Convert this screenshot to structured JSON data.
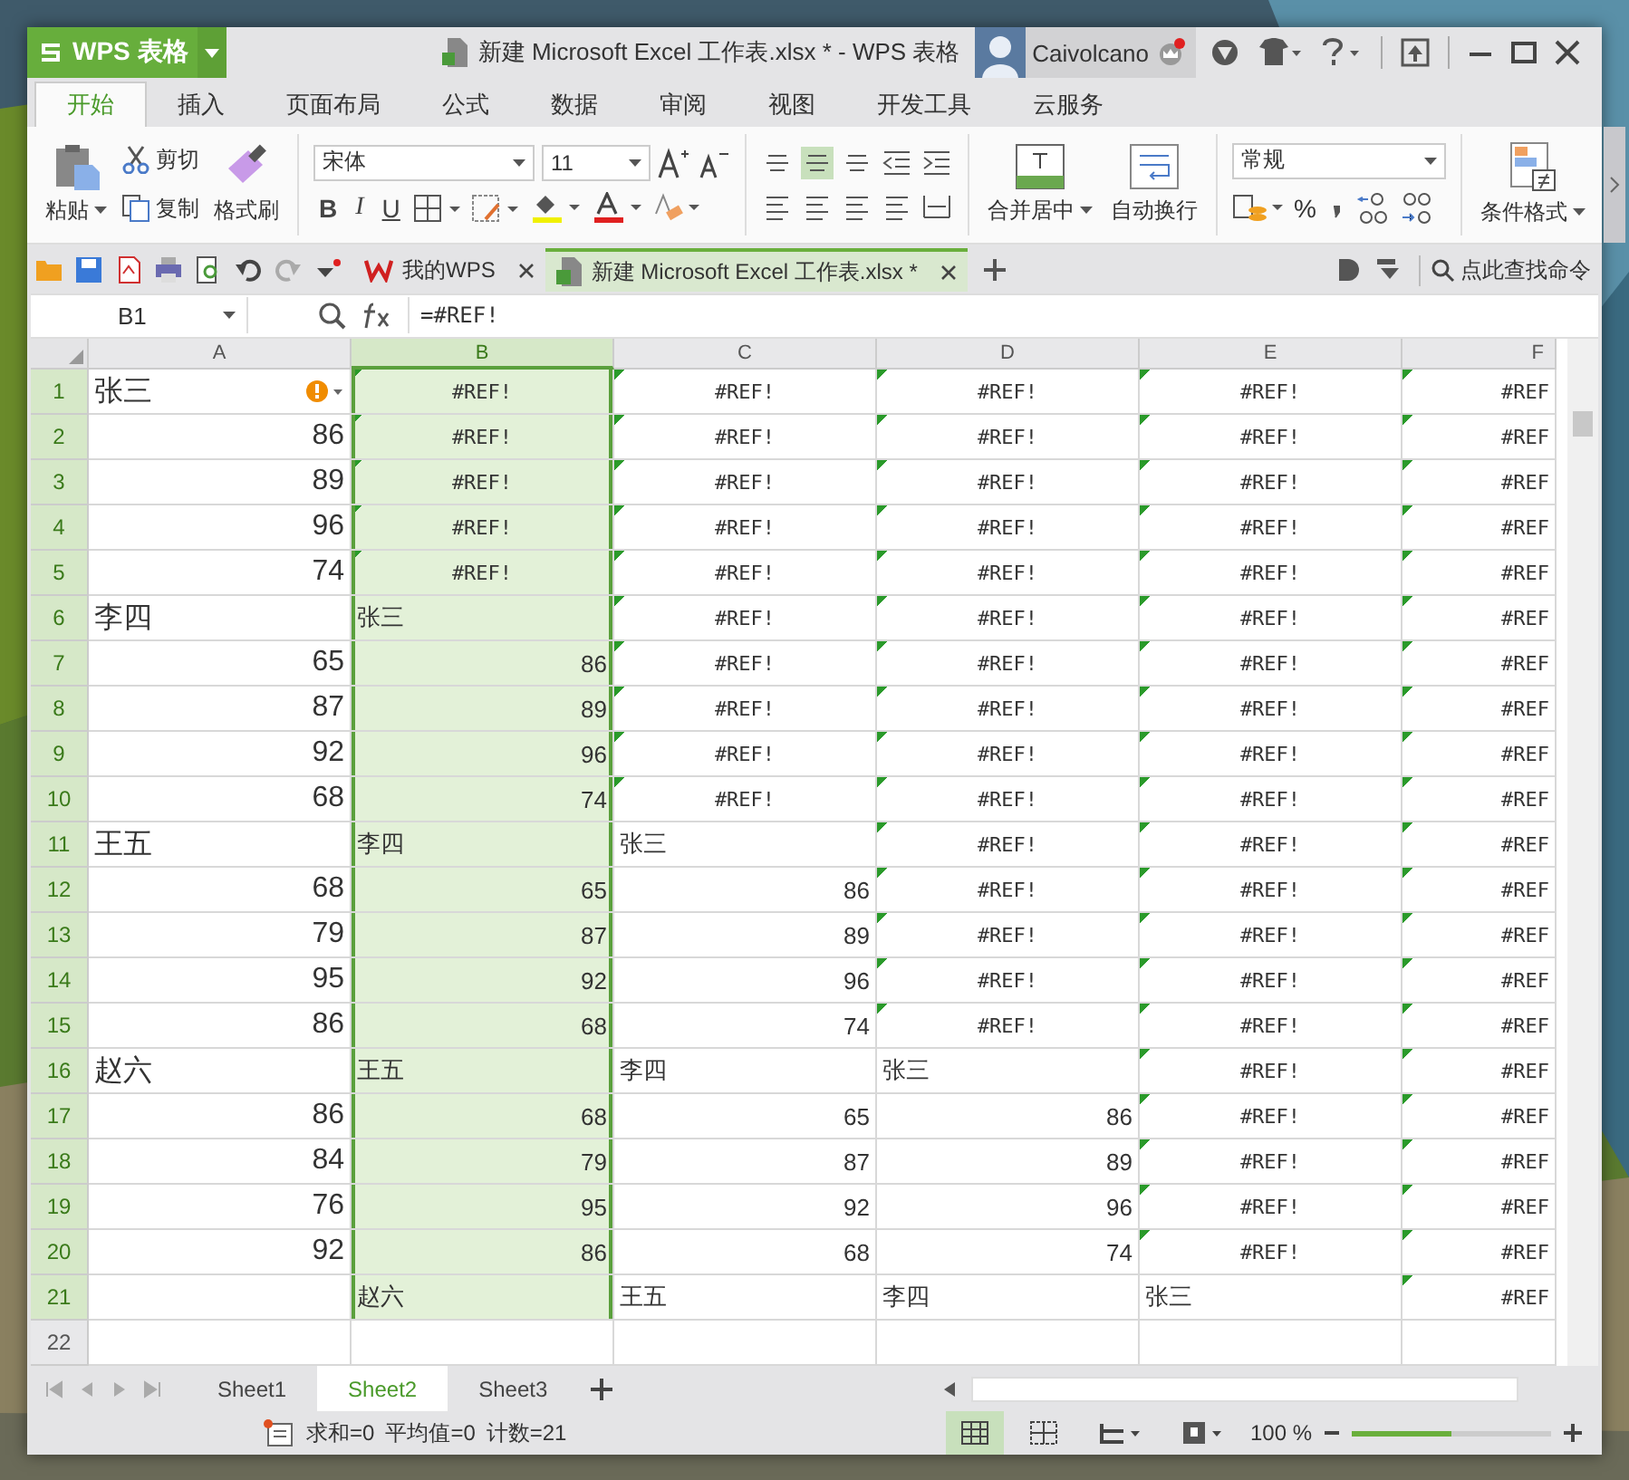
{
  "app_button": {
    "label": "WPS 表格"
  },
  "window": {
    "title": "新建 Microsoft Excel 工作表.xlsx * - WPS 表格"
  },
  "user": {
    "name": "Caivolcano",
    "notification": true
  },
  "ribbon_tabs": [
    {
      "label": "开始",
      "selected": true
    },
    {
      "label": "插入",
      "selected": false
    },
    {
      "label": "页面布局",
      "selected": false
    },
    {
      "label": "公式",
      "selected": false
    },
    {
      "label": "数据",
      "selected": false
    },
    {
      "label": "审阅",
      "selected": false
    },
    {
      "label": "视图",
      "selected": false
    },
    {
      "label": "开发工具",
      "selected": false
    },
    {
      "label": "云服务",
      "selected": false
    }
  ],
  "clipboard": {
    "paste": "粘贴",
    "cut": "剪切",
    "copy": "复制",
    "format_painter": "格式刷"
  },
  "font": {
    "name": "宋体",
    "size": "11"
  },
  "style_buttons": [
    "B",
    "I",
    "U"
  ],
  "alignment": {
    "merge": "合并居中",
    "wrap": "自动换行"
  },
  "number": {
    "format": "常规",
    "percent": "%"
  },
  "conditional_format": "条件格式",
  "doc_tabs": [
    {
      "label": "我的WPS",
      "kind": "home",
      "selected": false
    },
    {
      "label": "新建 Microsoft Excel 工作表.xlsx *",
      "kind": "sheet",
      "selected": true
    }
  ],
  "command_search": {
    "placeholder": "点此查找命令"
  },
  "formula_bar": {
    "name_box": "B1",
    "formula": "=#REF!"
  },
  "columns": [
    {
      "label": "A",
      "selected": false
    },
    {
      "label": "B",
      "selected": true
    },
    {
      "label": "C",
      "selected": false
    },
    {
      "label": "D",
      "selected": false
    },
    {
      "label": "E",
      "selected": false
    },
    {
      "label": "F",
      "selected": false
    }
  ],
  "rows": [
    {
      "label": "1",
      "selected": true,
      "cells": [
        {
          "kind": "name",
          "text": "张三",
          "warning": true
        },
        {
          "kind": "ref",
          "text": "#REF!"
        },
        {
          "kind": "ref",
          "text": "#REF!"
        },
        {
          "kind": "ref",
          "text": "#REF!"
        },
        {
          "kind": "ref",
          "text": "#REF!"
        },
        {
          "kind": "ref",
          "text": "#REF"
        }
      ]
    },
    {
      "label": "2",
      "selected": true,
      "cells": [
        {
          "kind": "num",
          "text": "86"
        },
        {
          "kind": "ref",
          "text": "#REF!"
        },
        {
          "kind": "ref",
          "text": "#REF!"
        },
        {
          "kind": "ref",
          "text": "#REF!"
        },
        {
          "kind": "ref",
          "text": "#REF!"
        },
        {
          "kind": "ref",
          "text": "#REF"
        }
      ]
    },
    {
      "label": "3",
      "selected": true,
      "cells": [
        {
          "kind": "num",
          "text": "89"
        },
        {
          "kind": "ref",
          "text": "#REF!"
        },
        {
          "kind": "ref",
          "text": "#REF!"
        },
        {
          "kind": "ref",
          "text": "#REF!"
        },
        {
          "kind": "ref",
          "text": "#REF!"
        },
        {
          "kind": "ref",
          "text": "#REF"
        }
      ]
    },
    {
      "label": "4",
      "selected": true,
      "cells": [
        {
          "kind": "num",
          "text": "96"
        },
        {
          "kind": "ref",
          "text": "#REF!"
        },
        {
          "kind": "ref",
          "text": "#REF!"
        },
        {
          "kind": "ref",
          "text": "#REF!"
        },
        {
          "kind": "ref",
          "text": "#REF!"
        },
        {
          "kind": "ref",
          "text": "#REF"
        }
      ]
    },
    {
      "label": "5",
      "selected": true,
      "cells": [
        {
          "kind": "num",
          "text": "74"
        },
        {
          "kind": "ref",
          "text": "#REF!"
        },
        {
          "kind": "ref",
          "text": "#REF!"
        },
        {
          "kind": "ref",
          "text": "#REF!"
        },
        {
          "kind": "ref",
          "text": "#REF!"
        },
        {
          "kind": "ref",
          "text": "#REF"
        }
      ]
    },
    {
      "label": "6",
      "selected": true,
      "cells": [
        {
          "kind": "name",
          "text": "李四"
        },
        {
          "kind": "name",
          "text": "张三"
        },
        {
          "kind": "ref",
          "text": "#REF!"
        },
        {
          "kind": "ref",
          "text": "#REF!"
        },
        {
          "kind": "ref",
          "text": "#REF!"
        },
        {
          "kind": "ref",
          "text": "#REF"
        }
      ]
    },
    {
      "label": "7",
      "selected": true,
      "cells": [
        {
          "kind": "num",
          "text": "65"
        },
        {
          "kind": "num",
          "text": "86"
        },
        {
          "kind": "ref",
          "text": "#REF!"
        },
        {
          "kind": "ref",
          "text": "#REF!"
        },
        {
          "kind": "ref",
          "text": "#REF!"
        },
        {
          "kind": "ref",
          "text": "#REF"
        }
      ]
    },
    {
      "label": "8",
      "selected": true,
      "cells": [
        {
          "kind": "num",
          "text": "87"
        },
        {
          "kind": "num",
          "text": "89"
        },
        {
          "kind": "ref",
          "text": "#REF!"
        },
        {
          "kind": "ref",
          "text": "#REF!"
        },
        {
          "kind": "ref",
          "text": "#REF!"
        },
        {
          "kind": "ref",
          "text": "#REF"
        }
      ]
    },
    {
      "label": "9",
      "selected": true,
      "cells": [
        {
          "kind": "num",
          "text": "92"
        },
        {
          "kind": "num",
          "text": "96"
        },
        {
          "kind": "ref",
          "text": "#REF!"
        },
        {
          "kind": "ref",
          "text": "#REF!"
        },
        {
          "kind": "ref",
          "text": "#REF!"
        },
        {
          "kind": "ref",
          "text": "#REF"
        }
      ]
    },
    {
      "label": "10",
      "selected": true,
      "cells": [
        {
          "kind": "num",
          "text": "68"
        },
        {
          "kind": "num",
          "text": "74"
        },
        {
          "kind": "ref",
          "text": "#REF!"
        },
        {
          "kind": "ref",
          "text": "#REF!"
        },
        {
          "kind": "ref",
          "text": "#REF!"
        },
        {
          "kind": "ref",
          "text": "#REF"
        }
      ]
    },
    {
      "label": "11",
      "selected": true,
      "cells": [
        {
          "kind": "name",
          "text": "王五"
        },
        {
          "kind": "name",
          "text": "李四"
        },
        {
          "kind": "name",
          "text": "张三"
        },
        {
          "kind": "ref",
          "text": "#REF!"
        },
        {
          "kind": "ref",
          "text": "#REF!"
        },
        {
          "kind": "ref",
          "text": "#REF"
        }
      ]
    },
    {
      "label": "12",
      "selected": true,
      "cells": [
        {
          "kind": "num",
          "text": "68"
        },
        {
          "kind": "num",
          "text": "65"
        },
        {
          "kind": "num",
          "text": "86"
        },
        {
          "kind": "ref",
          "text": "#REF!"
        },
        {
          "kind": "ref",
          "text": "#REF!"
        },
        {
          "kind": "ref",
          "text": "#REF"
        }
      ]
    },
    {
      "label": "13",
      "selected": true,
      "cells": [
        {
          "kind": "num",
          "text": "79"
        },
        {
          "kind": "num",
          "text": "87"
        },
        {
          "kind": "num",
          "text": "89"
        },
        {
          "kind": "ref",
          "text": "#REF!"
        },
        {
          "kind": "ref",
          "text": "#REF!"
        },
        {
          "kind": "ref",
          "text": "#REF"
        }
      ]
    },
    {
      "label": "14",
      "selected": true,
      "cells": [
        {
          "kind": "num",
          "text": "95"
        },
        {
          "kind": "num",
          "text": "92"
        },
        {
          "kind": "num",
          "text": "96"
        },
        {
          "kind": "ref",
          "text": "#REF!"
        },
        {
          "kind": "ref",
          "text": "#REF!"
        },
        {
          "kind": "ref",
          "text": "#REF"
        }
      ]
    },
    {
      "label": "15",
      "selected": true,
      "cells": [
        {
          "kind": "num",
          "text": "86"
        },
        {
          "kind": "num",
          "text": "68"
        },
        {
          "kind": "num",
          "text": "74"
        },
        {
          "kind": "ref",
          "text": "#REF!"
        },
        {
          "kind": "ref",
          "text": "#REF!"
        },
        {
          "kind": "ref",
          "text": "#REF"
        }
      ]
    },
    {
      "label": "16",
      "selected": true,
      "cells": [
        {
          "kind": "name",
          "text": "赵六"
        },
        {
          "kind": "name",
          "text": "王五"
        },
        {
          "kind": "name",
          "text": "李四"
        },
        {
          "kind": "name",
          "text": "张三"
        },
        {
          "kind": "ref",
          "text": "#REF!"
        },
        {
          "kind": "ref",
          "text": "#REF"
        }
      ]
    },
    {
      "label": "17",
      "selected": true,
      "cells": [
        {
          "kind": "num",
          "text": "86"
        },
        {
          "kind": "num",
          "text": "68"
        },
        {
          "kind": "num",
          "text": "65"
        },
        {
          "kind": "num",
          "text": "86"
        },
        {
          "kind": "ref",
          "text": "#REF!"
        },
        {
          "kind": "ref",
          "text": "#REF"
        }
      ]
    },
    {
      "label": "18",
      "selected": true,
      "cells": [
        {
          "kind": "num",
          "text": "84"
        },
        {
          "kind": "num",
          "text": "79"
        },
        {
          "kind": "num",
          "text": "87"
        },
        {
          "kind": "num",
          "text": "89"
        },
        {
          "kind": "ref",
          "text": "#REF!"
        },
        {
          "kind": "ref",
          "text": "#REF"
        }
      ]
    },
    {
      "label": "19",
      "selected": true,
      "cells": [
        {
          "kind": "num",
          "text": "76"
        },
        {
          "kind": "num",
          "text": "95"
        },
        {
          "kind": "num",
          "text": "92"
        },
        {
          "kind": "num",
          "text": "96"
        },
        {
          "kind": "ref",
          "text": "#REF!"
        },
        {
          "kind": "ref",
          "text": "#REF"
        }
      ]
    },
    {
      "label": "20",
      "selected": true,
      "cells": [
        {
          "kind": "num",
          "text": "92"
        },
        {
          "kind": "num",
          "text": "86"
        },
        {
          "kind": "num",
          "text": "68"
        },
        {
          "kind": "num",
          "text": "74"
        },
        {
          "kind": "ref",
          "text": "#REF!"
        },
        {
          "kind": "ref",
          "text": "#REF"
        }
      ]
    },
    {
      "label": "21",
      "selected": true,
      "cells": [
        {
          "kind": "empty"
        },
        {
          "kind": "name",
          "text": "赵六"
        },
        {
          "kind": "name",
          "text": "王五"
        },
        {
          "kind": "name",
          "text": "李四"
        },
        {
          "kind": "name",
          "text": "张三"
        },
        {
          "kind": "ref",
          "text": "#REF"
        }
      ]
    },
    {
      "label": "22",
      "selected": false,
      "cells": [
        {
          "kind": "empty"
        },
        {
          "kind": "empty"
        },
        {
          "kind": "empty"
        },
        {
          "kind": "empty"
        },
        {
          "kind": "empty"
        },
        {
          "kind": "empty"
        }
      ]
    }
  ],
  "sheet_tabs": [
    {
      "label": "Sheet1",
      "selected": false
    },
    {
      "label": "Sheet2",
      "selected": true
    },
    {
      "label": "Sheet3",
      "selected": false
    }
  ],
  "status_bar": {
    "sum": "求和=0",
    "average": "平均值=0",
    "count": "计数=21",
    "zoom": "100 %",
    "zoom_slider": {
      "level": 0.5
    }
  }
}
